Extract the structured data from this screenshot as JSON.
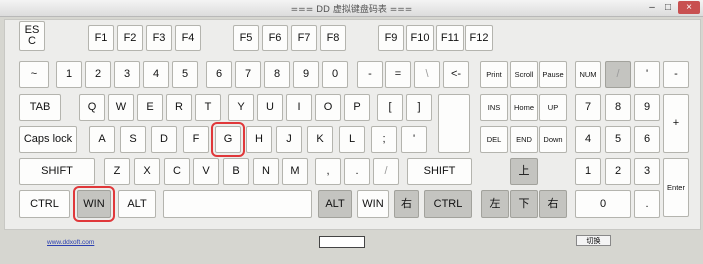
{
  "window": {
    "title": "=== DD 虚拟键盘码表 ===",
    "minimize": "–",
    "maximize": "□",
    "close": "×"
  },
  "keys": {
    "esc": "ES C",
    "f1": "F1",
    "f2": "F2",
    "f3": "F3",
    "f4": "F4",
    "f5": "F5",
    "f6": "F6",
    "f7": "F7",
    "f8": "F8",
    "f9": "F9",
    "f10": "F10",
    "f11": "F11",
    "f12": "F12",
    "tilde": "~",
    "n1": "1",
    "n2": "2",
    "n3": "3",
    "n4": "4",
    "n5": "5",
    "n6": "6",
    "n7": "7",
    "n8": "8",
    "n9": "9",
    "n0": "0",
    "minus": "-",
    "equals": "=",
    "backslash": "\\",
    "backspace": "<-",
    "print": "Print",
    "scroll": "Scroll",
    "pause": "Pause",
    "numlock": "NUM",
    "num_slash": "/",
    "num_star": "'",
    "num_minus": "-",
    "tab": "TAB",
    "q": "Q",
    "w": "W",
    "e": "E",
    "r": "R",
    "t": "T",
    "y": "Y",
    "u": "U",
    "i": "I",
    "o": "O",
    "p": "P",
    "lbracket": "[",
    "rbracket": "]",
    "ins": "INS",
    "home": "Home",
    "pgup": "UP",
    "num7": "7",
    "num8": "8",
    "num9": "9",
    "num_plus": "+",
    "caps": "Caps lock",
    "a": "A",
    "s": "S",
    "d": "D",
    "f": "F",
    "g": "G",
    "h": "H",
    "j": "J",
    "k": "K",
    "l": "L",
    "semicolon": ";",
    "quote": "'",
    "del": "DEL",
    "end": "END",
    "pgdn": "Down",
    "num4": "4",
    "num5": "5",
    "num6": "6",
    "lshift": "SHIFT",
    "z": "Z",
    "x": "X",
    "c": "C",
    "v": "V",
    "b": "B",
    "n": "N",
    "m": "M",
    "comma": ",",
    "period": ".",
    "slash": "/",
    "rshift": "SHIFT",
    "up": "上",
    "num1": "1",
    "num2": "2",
    "num3": "3",
    "num_enter": "Enter",
    "lctrl": "CTRL",
    "lwin": "WIN",
    "lalt": "ALT",
    "ralt": "ALT",
    "rwin": "WIN",
    "menu": "右",
    "rctrl": "CTRL",
    "left": "左",
    "down": "下",
    "right": "右",
    "num0": "0",
    "num_dot": "."
  },
  "footer": {
    "link": "www.ddxoft.com",
    "switch_label": "切换"
  }
}
